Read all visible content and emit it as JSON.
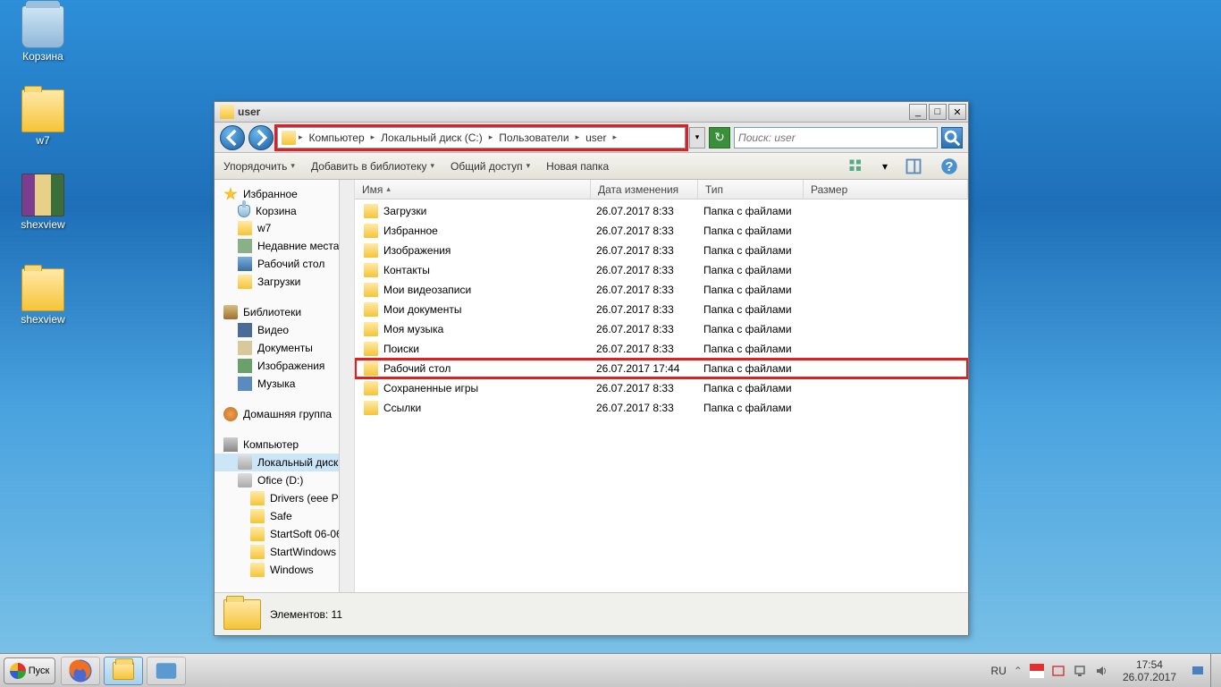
{
  "desktop_icons": {
    "recycle": "Корзина",
    "w7": "w7",
    "shexview1": "shexview",
    "shexview2": "shexview"
  },
  "window": {
    "title": "user",
    "breadcrumb": [
      "Компьютер",
      "Локальный диск (C:)",
      "Пользователи",
      "user"
    ],
    "search_placeholder": "Поиск: user"
  },
  "toolbar": {
    "organize": "Упорядочить",
    "addlib": "Добавить в библиотеку",
    "share": "Общий доступ",
    "newfolder": "Новая папка"
  },
  "nav": {
    "favorites": "Избранное",
    "fav_items": [
      "Корзина",
      "w7",
      "Недавние места",
      "Рабочий стол",
      "Загрузки"
    ],
    "libraries": "Библиотеки",
    "lib_items": [
      "Видео",
      "Документы",
      "Изображения",
      "Музыка"
    ],
    "homegroup": "Домашняя группа",
    "computer": "Компьютер",
    "drives": [
      "Локальный диск (",
      "Ofice (D:)"
    ],
    "d_sub": [
      "Drivers (eee PC",
      "Safe",
      "StartSoft 06-06-",
      "StartWindows",
      "Windows"
    ]
  },
  "columns": {
    "name": "Имя",
    "date": "Дата изменения",
    "type": "Тип",
    "size": "Размер"
  },
  "files": [
    {
      "name": "Загрузки",
      "date": "26.07.2017 8:33",
      "type": "Папка с файлами"
    },
    {
      "name": "Избранное",
      "date": "26.07.2017 8:33",
      "type": "Папка с файлами"
    },
    {
      "name": "Изображения",
      "date": "26.07.2017 8:33",
      "type": "Папка с файлами"
    },
    {
      "name": "Контакты",
      "date": "26.07.2017 8:33",
      "type": "Папка с файлами"
    },
    {
      "name": "Мои видеозаписи",
      "date": "26.07.2017 8:33",
      "type": "Папка с файлами"
    },
    {
      "name": "Мои документы",
      "date": "26.07.2017 8:33",
      "type": "Папка с файлами"
    },
    {
      "name": "Моя музыка",
      "date": "26.07.2017 8:33",
      "type": "Папка с файлами"
    },
    {
      "name": "Поиски",
      "date": "26.07.2017 8:33",
      "type": "Папка с файлами"
    },
    {
      "name": "Рабочий стол",
      "date": "26.07.2017 17:44",
      "type": "Папка с файлами",
      "hl": true
    },
    {
      "name": "Сохраненные игры",
      "date": "26.07.2017 8:33",
      "type": "Папка с файлами"
    },
    {
      "name": "Ссылки",
      "date": "26.07.2017 8:33",
      "type": "Папка с файлами"
    }
  ],
  "status": "Элементов: 11",
  "taskbar": {
    "start": "Пуск",
    "lang": "RU",
    "time": "17:54",
    "date": "26.07.2017"
  }
}
